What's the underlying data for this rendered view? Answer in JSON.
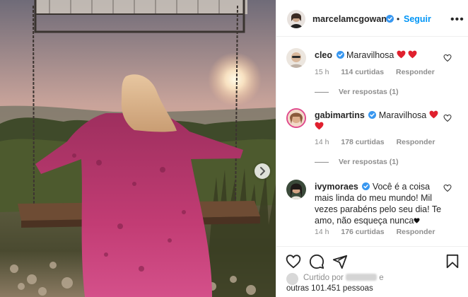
{
  "post": {
    "author": {
      "username": "marcelamcgowan",
      "verified": true,
      "follow_label": "Seguir",
      "dot": "•"
    },
    "comments": [
      {
        "username": "cleo",
        "verified": true,
        "text": "Maravilhosa",
        "emoji": [
          "red-heart",
          "red-heart"
        ],
        "time": "15 h",
        "likes": "114 curtidas",
        "reply_label": "Responder",
        "view_replies": "Ver respostas (1)"
      },
      {
        "username": "gabimartins",
        "verified": true,
        "text": "Maravilhosa",
        "emoji": [
          "red-heart",
          "red-heart"
        ],
        "time": "14 h",
        "likes": "178 curtidas",
        "reply_label": "Responder",
        "view_replies": "Ver respostas (1)"
      },
      {
        "username": "ivymoraes",
        "verified": true,
        "text": "Você é a coisa mais linda do meu mundo! Mil vezes parabéns pelo seu dia! Te amo, não esqueça nunca",
        "emoji": [
          "black-heart"
        ],
        "time": "14 h",
        "likes": "176 curtidas",
        "reply_label": "Responder"
      }
    ],
    "liked_by": {
      "prefix": "Curtido por",
      "connector": "e",
      "others": "outras 101.451 pessoas"
    },
    "icons": {
      "like": "heart-outline-icon",
      "comment": "speech-bubble-icon",
      "share": "paper-plane-icon",
      "save": "bookmark-icon",
      "carousel_next": "chevron-right-icon"
    },
    "colors": {
      "accent": "#0095f6",
      "verified": "#3897f0",
      "heart_red": "#ed4956",
      "muted_text": "#8e8e8e"
    }
  }
}
